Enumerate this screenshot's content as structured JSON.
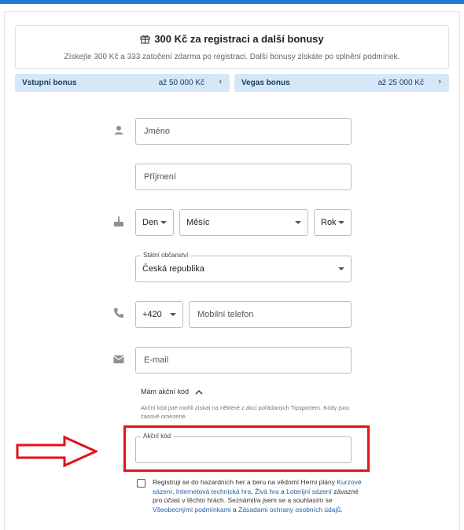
{
  "promo": {
    "title": "300 Kč za registraci a další bonusy",
    "subtitle": "Získejte 300 Kč a 333 zatočení zdarma po registraci. Další bonusy získáte po splnění podmínek."
  },
  "bonuses": [
    {
      "name": "Vstupní bonus",
      "amount": "až 50 000 Kč",
      "chevron": "›"
    },
    {
      "name": "Vegas bonus",
      "amount": "až 25 000 Kč",
      "chevron": "›"
    }
  ],
  "form": {
    "first_name": {
      "placeholder": "Jméno"
    },
    "last_name": {
      "placeholder": "Příjmení"
    },
    "birth": {
      "day": "Den",
      "month": "Měsíc",
      "year": "Rok"
    },
    "citizenship": {
      "label": "Státní občanství",
      "value": "Česká republika"
    },
    "phone": {
      "prefix": "+420",
      "placeholder": "Mobilní telefon"
    },
    "email": {
      "placeholder": "E-mail"
    },
    "promo_toggle": "Mám akční kód",
    "promo_hint": "Akční kód jste mohli získat na některé z akcí pořádaných Tipsportem. Kódy jsou časově omezené.",
    "promo_code_label": "Akční kód"
  },
  "consent": {
    "t1": "Registruji se do hazardních her a beru na vědomí Herní plány ",
    "l1": "Kurzové sázení",
    "t2": ", ",
    "l2": "Internetová technická hra",
    "t3": ", ",
    "l3": "Živá hra",
    "t4": " a ",
    "l4": "Loterijní sázení",
    "t5": " závazné pro účast v těchto hrách. Seznámil/a jsem se a souhlasím se ",
    "l5": "Všeobecnými podmínkami",
    "t6": " a ",
    "l6": "Zásadami ochrany osobních údajů",
    "t7": "."
  },
  "colors": {
    "accent": "#1e7bd6",
    "bonus_bg": "#d6e7f8",
    "highlight": "#e3121d"
  },
  "icons": [
    "gift-icon",
    "person-icon",
    "cake-icon",
    "phone-icon",
    "mail-icon",
    "chevron-up-icon",
    "caret-down-icon",
    "arrow-annotation"
  ]
}
